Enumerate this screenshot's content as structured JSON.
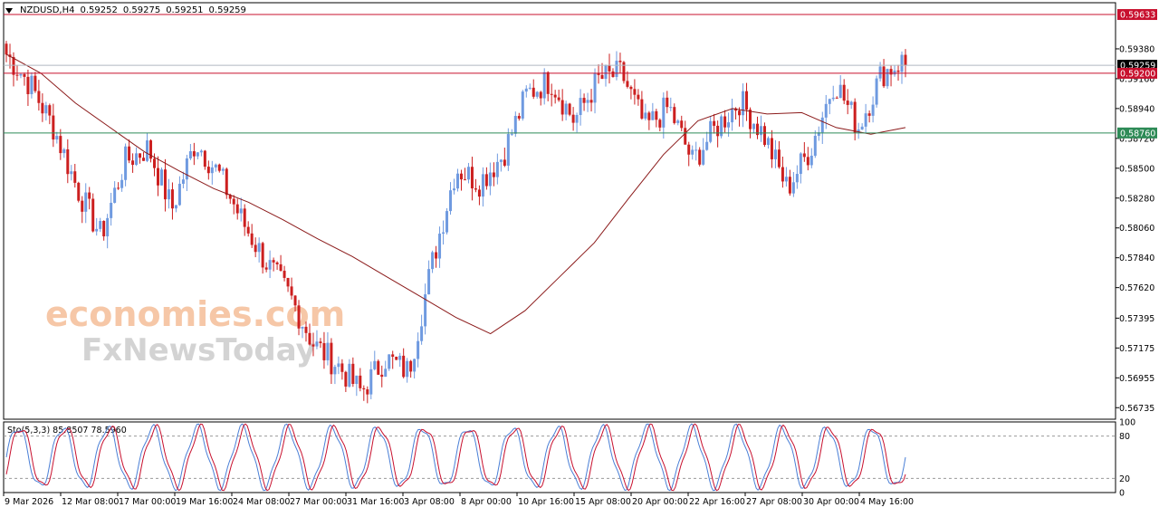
{
  "chart_data": [
    {
      "type": "candlestick",
      "symbol_header": {
        "symbol": "NZDUSD,H4",
        "ohlc": [
          "0.59252",
          "0.59275",
          "0.59251",
          "0.59259"
        ]
      },
      "y_tick_labels": [
        "0.59380",
        "0.59160",
        "0.58940",
        "0.58720",
        "0.58500",
        "0.58280",
        "0.58060",
        "0.57840",
        "0.57620",
        "0.57395",
        "0.57175",
        "0.56955",
        "0.56735"
      ],
      "ylim": [
        0.5665,
        0.5972
      ],
      "x_tick_labels": [
        "9 Mar 2026",
        "12 Mar 08:00",
        "17 Mar 00:00",
        "19 Mar 16:00",
        "24 Mar 08:00",
        "27 Mar 00:00",
        "31 Mar 16:00",
        "3 Apr 08:00",
        "8 Apr 00:00",
        "10 Apr 16:00",
        "15 Apr 08:00",
        "20 Apr 00:00",
        "22 Apr 16:00",
        "27 Apr 08:00",
        "30 Apr 00:00",
        "4 May 16:00"
      ],
      "horizontal_lines": [
        {
          "value": 0.59633,
          "label": "0.59633",
          "color": "#c8102e"
        },
        {
          "value": 0.59259,
          "label": "0.59259",
          "color": "#000000",
          "line_color": "#b0b8c0"
        },
        {
          "value": 0.592,
          "label": "0.59200",
          "color": "#c8102e"
        },
        {
          "value": 0.5876,
          "label": "0.58760",
          "color": "#2e8b57"
        }
      ],
      "series": [
        {
          "name": "",
          "kind": "moving-average",
          "color": "#8b1a1a",
          "values": [
            0.5934,
            0.592,
            0.5898,
            0.588,
            0.5862,
            0.5848,
            0.5835,
            0.5825,
            0.5812,
            0.5798,
            0.5785,
            0.577,
            0.5755,
            0.574,
            0.5728,
            0.5745,
            0.577,
            0.5795,
            0.5828,
            0.586,
            0.5885,
            0.5894,
            0.589,
            0.5891,
            0.588,
            0.5875,
            0.588
          ]
        }
      ],
      "ohlc_anchor_closes": [
        0.5934,
        0.5912,
        0.588,
        0.5835,
        0.58,
        0.5855,
        0.5865,
        0.582,
        0.587,
        0.5845,
        0.581,
        0.578,
        0.5755,
        0.572,
        0.5705,
        0.5685,
        0.571,
        0.57,
        0.578,
        0.585,
        0.584,
        0.586,
        0.5905,
        0.5915,
        0.5885,
        0.5915,
        0.592,
        0.588,
        0.5895,
        0.5855,
        0.588,
        0.59,
        0.5875,
        0.5835,
        0.5865,
        0.5915,
        0.588,
        0.592,
        0.593
      ],
      "colors": {
        "up": "#6f9ae0",
        "down": "#cc1f1f",
        "grid": "#dfe3e8",
        "axis": "#000000"
      },
      "watermark": [
        "economies.com",
        "FxNewsToday"
      ]
    },
    {
      "type": "line",
      "indicator_label": "Sto(5,3,3) 85.8507 78.5960",
      "ylim": [
        0,
        100
      ],
      "y_tick_labels": [
        "100",
        "80",
        "20",
        "0"
      ],
      "levels": [
        20,
        80
      ],
      "series": [
        {
          "name": "",
          "color": "#4a7fd6",
          "cycles": 20
        },
        {
          "name": "",
          "color": "#c8102e",
          "cycles": 20
        }
      ]
    }
  ]
}
